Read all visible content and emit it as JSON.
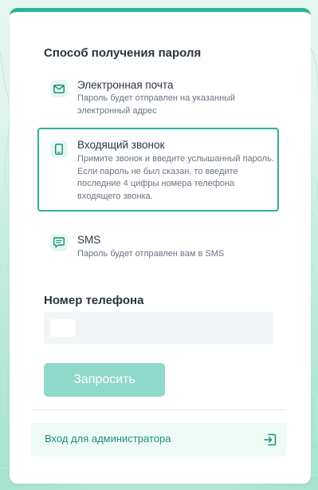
{
  "delivery": {
    "title": "Способ получения пароля",
    "options": [
      {
        "icon": "mail-icon",
        "title": "Электронная почта",
        "description": "Пароль будет отправлен на указанный электронный адрес",
        "selected": false
      },
      {
        "icon": "phone-icon",
        "title": "Входящий звонок",
        "description": "Примите звонок и введите услышанный пароль. Если пароль не был сказан, то введите последние 4 цифры номера телефона входящего звонка.",
        "selected": true
      },
      {
        "icon": "chat-icon",
        "title": "SMS",
        "description": "Пароль будет отправлен вам в SMS",
        "selected": false
      }
    ]
  },
  "phone": {
    "label": "Номер телефона",
    "value": "",
    "placeholder": ""
  },
  "actions": {
    "request_label": "Запросить",
    "admin_label": "Вход для администратора",
    "admin_icon": "login-icon"
  },
  "colors": {
    "accent": "#2ab49a",
    "button_disabled": "#8fd8ca",
    "link": "#1d8f7b"
  }
}
